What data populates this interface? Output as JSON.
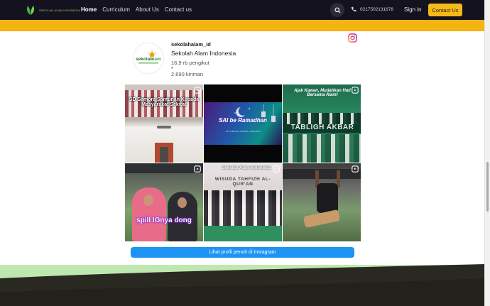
{
  "header": {
    "logo_text": "SEKOLAH ALAM INDONESIA",
    "nav": [
      {
        "label": "Home",
        "active": true
      },
      {
        "label": "Curriculum",
        "active": false
      },
      {
        "label": "About Us",
        "active": false
      },
      {
        "label": "Contact us",
        "active": false
      }
    ],
    "phone": "0217502131678",
    "signin_label": "Sign in",
    "contact_label": "Contact Us",
    "icons": {
      "search": "search-icon",
      "phone": "phone-icon"
    }
  },
  "colors": {
    "navbar": "#15121f",
    "accent": "#f4b412",
    "button_blue": "#1d94f3",
    "footer_green": "#bfe8b0",
    "footer_dark": "#2b2a22"
  },
  "instagram": {
    "icon": "instagram-icon",
    "handle": "sekolahalam_id",
    "name": "Sekolah Alam Indonesia",
    "followers": "16,9 rb pengikut",
    "separator": "•",
    "posts": "2.690 kiriman",
    "avatar_text": "sekolah alam",
    "tiles": [
      {
        "caption": "SD Samora Santunan Kepada Masyarakat Sekitar",
        "badge": "reel-icon"
      },
      {
        "caption": "SAI be Ramadhan",
        "subcaption": "Jum'at Berkah, Sedekah, Silaturahmi",
        "badge": "reel-icon"
      },
      {
        "caption": "Ajak Kawan, Mudahkan Hati Bersama Alam!",
        "caption2": "TABLIGH AKBAR",
        "badge": "reel-icon"
      },
      {
        "caption": "spill IGnya dong",
        "badge": "reel-icon"
      },
      {
        "caption": "Sekolah Alam Indonesia",
        "caption2": "WISUDA TAHFIZH AL-QUR'AN",
        "badge": "reel-icon"
      },
      {
        "caption": "",
        "badge": "reel-icon"
      }
    ],
    "profile_button": "Lihat profil penuh di Instagram"
  }
}
